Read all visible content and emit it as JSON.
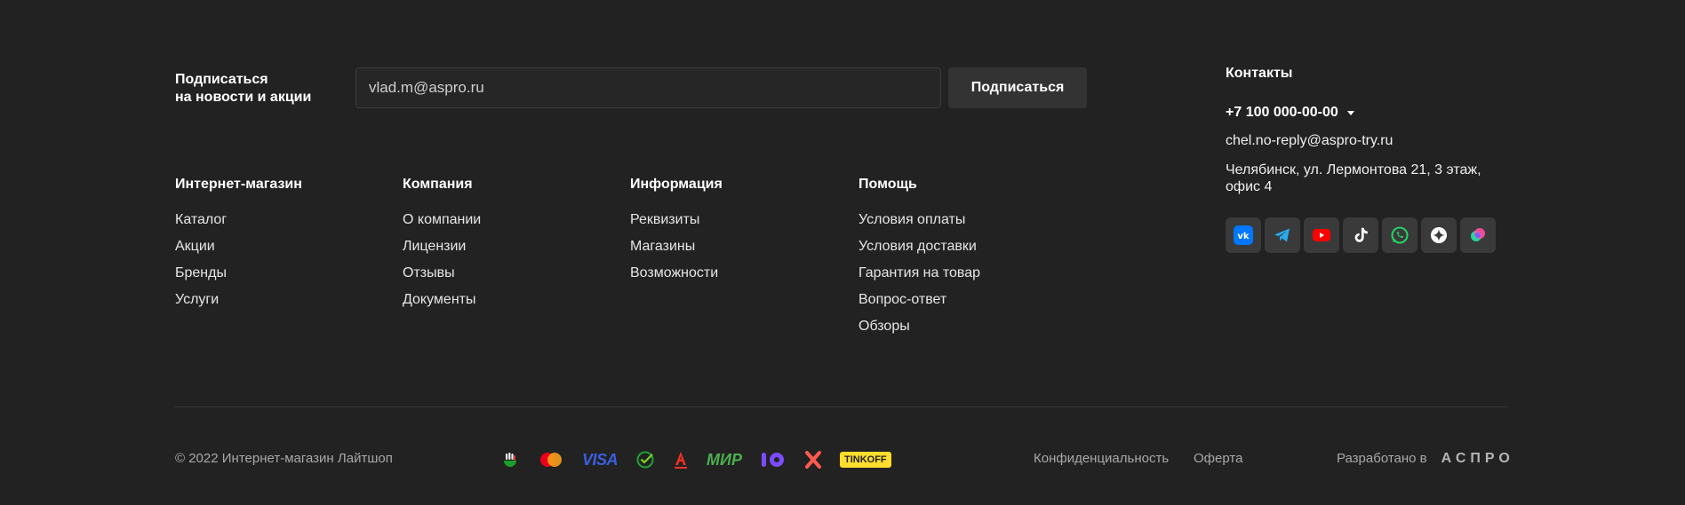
{
  "subscribe": {
    "label_line1": "Подписаться",
    "label_line2": "на новости и акции",
    "email_value": "vlad.m@aspro.ru",
    "button_label": "Подписаться"
  },
  "menus": [
    {
      "title": "Интернет-магазин",
      "items": [
        "Каталог",
        "Акции",
        "Бренды",
        "Услуги"
      ]
    },
    {
      "title": "Компания",
      "items": [
        "О компании",
        "Лицензии",
        "Отзывы",
        "Документы"
      ]
    },
    {
      "title": "Информация",
      "items": [
        "Реквизиты",
        "Магазины",
        "Возможности"
      ]
    },
    {
      "title": "Помощь",
      "items": [
        "Условия оплаты",
        "Условия доставки",
        "Гарантия на товар",
        "Вопрос-ответ",
        "Обзоры"
      ]
    }
  ],
  "contacts": {
    "title": "Контакты",
    "phone": "+7 100 000-00-00",
    "email": "chel.no-reply@aspro-try.ru",
    "address": "Челябинск, ул. Лермонтова 21, 3 этаж, офис 4"
  },
  "socials": [
    "vk-icon",
    "telegram-icon",
    "youtube-icon",
    "tiktok-icon",
    "whatsapp-icon",
    "zen-icon",
    "odnoklassniki-icon"
  ],
  "bottom": {
    "copyright": "© 2022 Интернет-магазин Лайтшоп",
    "payments": {
      "visa": "VISA",
      "mir": "МИР",
      "tinkoff": "TINKOFF"
    },
    "privacy": "Конфиденциальность",
    "offer": "Оферта",
    "developed_by": "Разработано в",
    "developer": "АСПРО"
  },
  "colors": {
    "background": "#222222",
    "vk": "#0077ff",
    "telegram": "#2aabee",
    "youtube": "#ff0000",
    "whatsapp": "#25d366"
  }
}
